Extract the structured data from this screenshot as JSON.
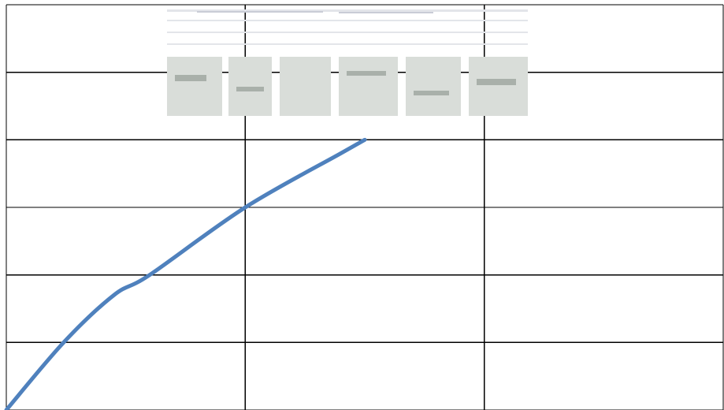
{
  "colors": {
    "background": "#ffffff",
    "grid": "#000000",
    "series": "#4f81bd",
    "watermark": "#c9ccd6"
  },
  "chart_data": {
    "type": "line",
    "title": "",
    "xlabel": "",
    "ylabel": "",
    "grid": true,
    "grid_columns": 3,
    "grid_rows": 6,
    "xlim": [
      0,
      3
    ],
    "ylim": [
      0,
      6
    ],
    "legend": "none",
    "watermark": "logo",
    "series": [
      {
        "color": "#4f81bd",
        "x": [
          0.0,
          0.24,
          0.45,
          0.6,
          1.0,
          1.4,
          1.5
        ],
        "y": [
          0.0,
          1.0,
          1.7,
          2.0,
          3.0,
          3.8,
          4.0
        ]
      }
    ]
  }
}
